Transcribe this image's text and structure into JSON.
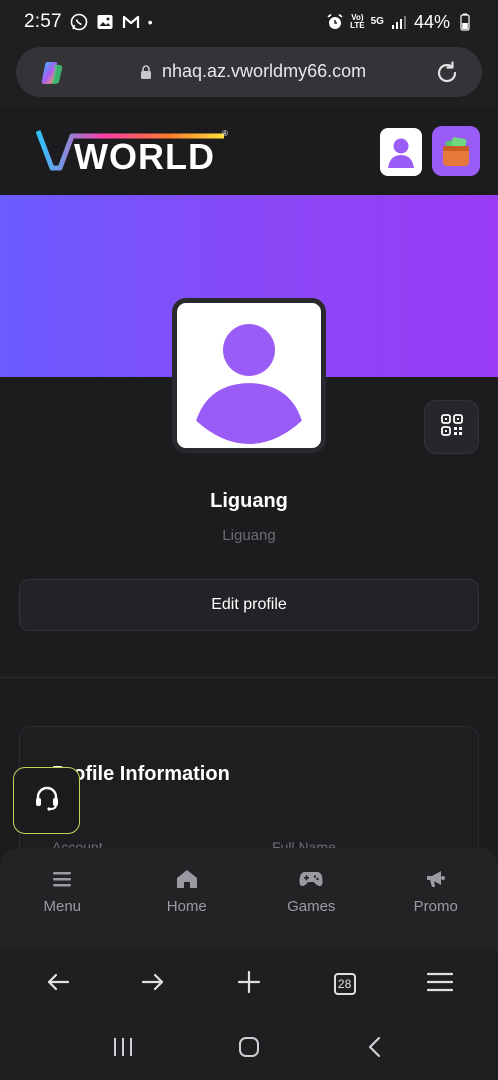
{
  "status_bar": {
    "time": "2:57",
    "dot": "•",
    "volte": "Vo)\nLTE",
    "network": "5G",
    "battery": "44%",
    "icons": [
      "whatsapp-icon",
      "gallery-icon",
      "gmail-icon",
      "alarm-icon",
      "signal-icon",
      "battery-icon"
    ]
  },
  "browser": {
    "url": "nhaq.az.vworldmy66.com",
    "tab_count": "28"
  },
  "header": {
    "logo_text": "VWORLD",
    "registered": "®"
  },
  "profile": {
    "name": "Liguang",
    "handle": "Liguang",
    "edit_label": "Edit profile"
  },
  "info": {
    "title": "Profile Information",
    "label_account": "Account",
    "label_fullname": "Full Name"
  },
  "nav": {
    "items": [
      {
        "label": "Menu",
        "icon": "hamburger-icon"
      },
      {
        "label": "Home",
        "icon": "home-icon"
      },
      {
        "label": "Games",
        "icon": "gamepad-icon"
      },
      {
        "label": "Promo",
        "icon": "megaphone-icon"
      }
    ]
  },
  "colors": {
    "banner_start": "#6a5cff",
    "banner_end": "#9a3cf6",
    "avatar_purple": "#9a5cf6",
    "support_border": "#c8d05a"
  }
}
